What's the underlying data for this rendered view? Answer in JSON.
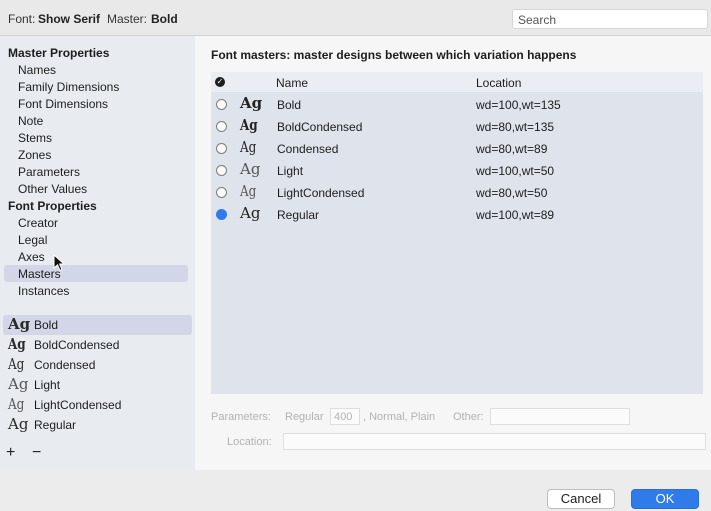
{
  "topbar": {
    "font_label": "Font:",
    "font_value": "Show Serif",
    "master_label": "Master:",
    "master_value": "Bold",
    "search_placeholder": "Search"
  },
  "sidebar": {
    "master_properties": {
      "heading": "Master Properties",
      "items": [
        "Names",
        "Family Dimensions",
        "Font Dimensions",
        "Note",
        "Stems",
        "Zones",
        "Parameters",
        "Other Values"
      ]
    },
    "font_properties": {
      "heading": "Font Properties",
      "items": [
        "Creator",
        "Legal",
        "Axes",
        "Masters",
        "Instances"
      ],
      "selected": "Masters"
    },
    "masters": [
      {
        "glyph": "Ag",
        "name": "Bold"
      },
      {
        "glyph": "Ag",
        "name": "BoldCondensed"
      },
      {
        "glyph": "Ag",
        "name": "Condensed"
      },
      {
        "glyph": "Ag",
        "name": "Light"
      },
      {
        "glyph": "Ag",
        "name": "LightCondensed"
      },
      {
        "glyph": "Ag",
        "name": "Regular"
      }
    ],
    "selected_master": "Bold",
    "add_label": "+",
    "remove_label": "−"
  },
  "main": {
    "title": "Font masters: master designs between which variation happens",
    "columns": {
      "name": "Name",
      "location": "Location"
    },
    "rows": [
      {
        "glyph": "Ag",
        "name": "Bold",
        "location": "wd=100,wt=135",
        "selected": false
      },
      {
        "glyph": "Ag",
        "name": "BoldCondensed",
        "location": "wd=80,wt=135",
        "selected": false
      },
      {
        "glyph": "Ag",
        "name": "Condensed",
        "location": "wd=80,wt=89",
        "selected": false
      },
      {
        "glyph": "Ag",
        "name": "Light",
        "location": "wd=100,wt=50",
        "selected": false
      },
      {
        "glyph": "Ag",
        "name": "LightCondensed",
        "location": "wd=80,wt=50",
        "selected": false
      },
      {
        "glyph": "Ag",
        "name": "Regular",
        "location": "wd=100,wt=89",
        "selected": true
      }
    ],
    "parameters": {
      "label": "Parameters:",
      "style": "Regular",
      "weight": "400",
      "suffix": ", Normal, Plain",
      "other_label": "Other:",
      "other_value": ""
    },
    "location": {
      "label": "Location:",
      "value": ""
    }
  },
  "buttons": {
    "cancel": "Cancel",
    "ok": "OK"
  },
  "colors": {
    "accent": "#2f7bea",
    "selection": "#d3d6e6",
    "table_bg": "#dfe3ec",
    "sidebar_bg": "#e8ecf1"
  }
}
